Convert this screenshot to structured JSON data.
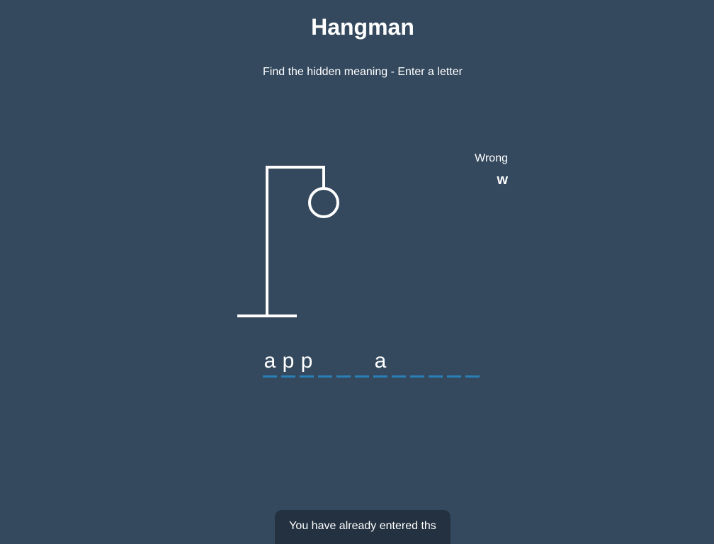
{
  "header": {
    "title": "Hangman",
    "subtitle": "Find the hidden meaning - Enter a letter"
  },
  "wrong": {
    "label": "Wrong",
    "letters": [
      "w"
    ]
  },
  "word": {
    "letters": [
      "a",
      "p",
      "p",
      "",
      "",
      "",
      "a",
      "",
      "",
      "",
      "",
      ""
    ]
  },
  "notification": {
    "text": "You have already entered ths"
  },
  "colors": {
    "background": "#34495e",
    "underline": "#2980b9",
    "notification_bg": "#233140",
    "foreground": "#ffffff"
  }
}
